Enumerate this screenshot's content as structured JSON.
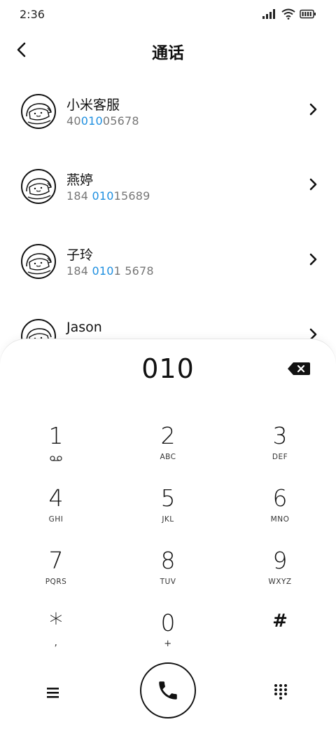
{
  "status_bar": {
    "time": "2:36"
  },
  "header": {
    "title": "通话"
  },
  "contacts": [
    {
      "name": "小米客服",
      "number_parts": [
        "40",
        "010",
        "05678"
      ]
    },
    {
      "name": "燕婷",
      "number_parts": [
        "184 ",
        "010",
        "15689"
      ]
    },
    {
      "name": "子玲",
      "number_parts": [
        "184 ",
        "010",
        "1 5678"
      ]
    },
    {
      "name": "Jason",
      "number_parts": [
        "",
        "",
        ""
      ]
    }
  ],
  "dialer": {
    "entry": "010",
    "keys": [
      {
        "digit": "1",
        "sub": ""
      },
      {
        "digit": "2",
        "sub": "ABC"
      },
      {
        "digit": "3",
        "sub": "DEF"
      },
      {
        "digit": "4",
        "sub": "GHI"
      },
      {
        "digit": "5",
        "sub": "JKL"
      },
      {
        "digit": "6",
        "sub": "MNO"
      },
      {
        "digit": "7",
        "sub": "PQRS"
      },
      {
        "digit": "8",
        "sub": "TUV"
      },
      {
        "digit": "9",
        "sub": "WXYZ"
      },
      {
        "digit": "*",
        "sub": ","
      },
      {
        "digit": "0",
        "sub": "+"
      },
      {
        "digit": "#",
        "sub": ""
      }
    ]
  },
  "icons": {
    "back": "chevron-left-icon",
    "chevron": "chevron-right-icon",
    "backspace": "backspace-icon",
    "voicemail": "voicemail-icon",
    "menu": "menu-icon",
    "call": "phone-icon",
    "keypad": "keypad-icon"
  },
  "colors": {
    "highlight": "#1e8fe0",
    "text": "#111111",
    "secondary": "#777777"
  }
}
